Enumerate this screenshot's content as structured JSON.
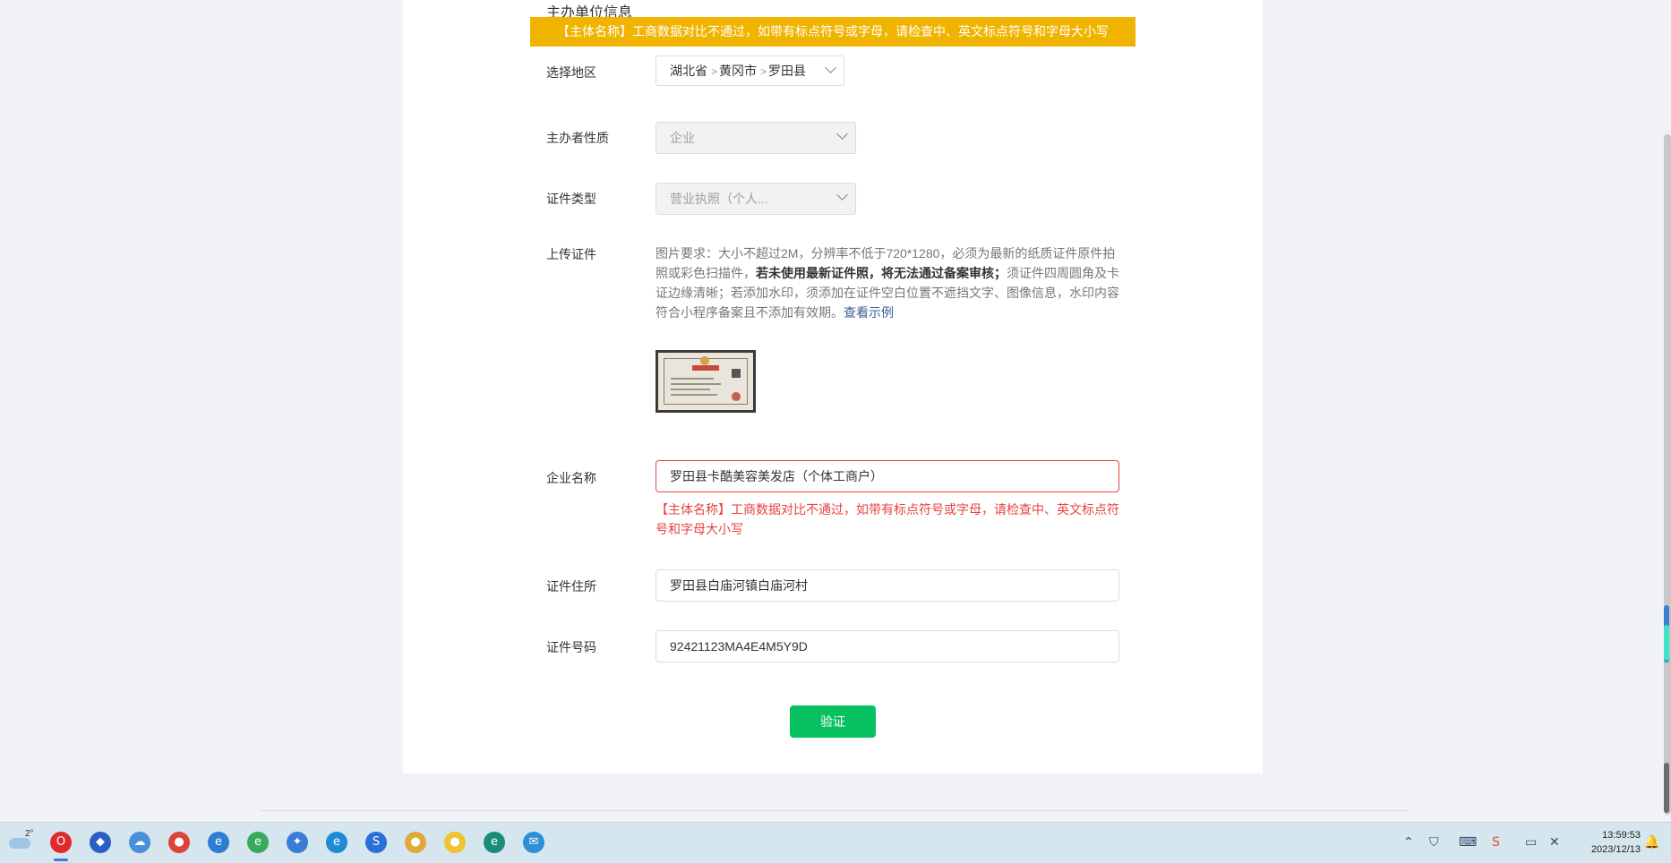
{
  "section": {
    "title": "主办单位信息"
  },
  "toast": {
    "message": "【主体名称】工商数据对比不通过，如带有标点符号或字母，请检查中、英文标点符号和字母大小写"
  },
  "form": {
    "region": {
      "label": "选择地区",
      "province": "湖北省",
      "city": "黄冈市",
      "county": "罗田县",
      "separator": ">"
    },
    "organizer_type": {
      "label": "主办者性质",
      "value": "企业"
    },
    "cert_type": {
      "label": "证件类型",
      "value": "营业执照（个人..."
    },
    "upload": {
      "label": "上传证件",
      "desc_part1": "图片要求：大小不超过2M，分辨率不低于720*1280，必须为最新的纸质证件原件拍照或彩色扫描件，",
      "desc_bold": "若未使用最新证件照，将无法通过备案审核；",
      "desc_part2": "须证件四周圆角及卡证边缘清晰；若添加水印，须添加在证件空白位置不遮挡文字、图像信息，水印内容符合小程序备案且不添加有效期。",
      "example_link": "查看示例"
    },
    "company_name": {
      "label": "企业名称",
      "value": "罗田县卡酷美容美发店（个体工商户）",
      "error": "【主体名称】工商数据对比不通过，如带有标点符号或字母，请检查中、英文标点符号和字母大小写"
    },
    "cert_address": {
      "label": "证件住所",
      "value": "罗田县白庙河镇白庙河村"
    },
    "cert_number": {
      "label": "证件号码",
      "value": "92421123MA4E4M5Y9D"
    },
    "verify_button": "验证"
  },
  "taskbar": {
    "weather_temp": "2°",
    "icons": [
      "opera-icon",
      "copilot-icon",
      "cloud-chat-icon",
      "chrome-icon",
      "edge-dev-icon",
      "ie-green-icon",
      "network-icon",
      "ie-icon",
      "sogou-icon",
      "chrome-alt-icon",
      "chrome-canary-icon",
      "edge-icon",
      "chat-icon"
    ],
    "clock_time": "13:59:53",
    "clock_date": "2023/12/13"
  },
  "colors": {
    "toast_bg": "#f0b400",
    "error_red": "#e64340",
    "primary_green": "#07c160",
    "link_blue": "#3a5a95"
  }
}
